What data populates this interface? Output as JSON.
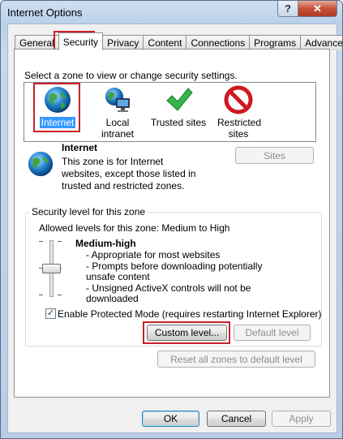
{
  "window": {
    "title": "Internet Options",
    "help_label": "?",
    "close_label": "✕"
  },
  "tabs": [
    {
      "label": "General"
    },
    {
      "label": "Security",
      "active": true
    },
    {
      "label": "Privacy"
    },
    {
      "label": "Content"
    },
    {
      "label": "Connections"
    },
    {
      "label": "Programs"
    },
    {
      "label": "Advanced"
    }
  ],
  "security": {
    "instruction": "Select a zone to view or change security settings.",
    "zones": [
      {
        "label": "Internet",
        "icon": "globe-icon",
        "selected": true
      },
      {
        "label": "Local intranet",
        "icon": "intranet-icon"
      },
      {
        "label": "Trusted sites",
        "icon": "checkmark-icon"
      },
      {
        "label": "Restricted sites",
        "icon": "restricted-icon"
      }
    ],
    "zone_title": "Internet",
    "zone_description": "This zone is for Internet websites, except those listed in trusted and restricted zones.",
    "sites_button": "Sites",
    "level_group_label": "Security level for this zone",
    "allowed_levels": "Allowed levels for this zone: Medium to High",
    "level_name": "Medium-high",
    "level_points": [
      "- Appropriate for most websites",
      "- Prompts before downloading potentially unsafe content",
      "- Unsigned ActiveX controls will not be downloaded"
    ],
    "protected_mode_label": "Enable Protected Mode (requires restarting Internet Explorer)",
    "protected_mode_checked": true,
    "custom_level_button": "Custom level...",
    "default_level_button": "Default level",
    "reset_all_button": "Reset all zones to default level"
  },
  "footer": {
    "ok": "OK",
    "cancel": "Cancel",
    "apply": "Apply"
  }
}
